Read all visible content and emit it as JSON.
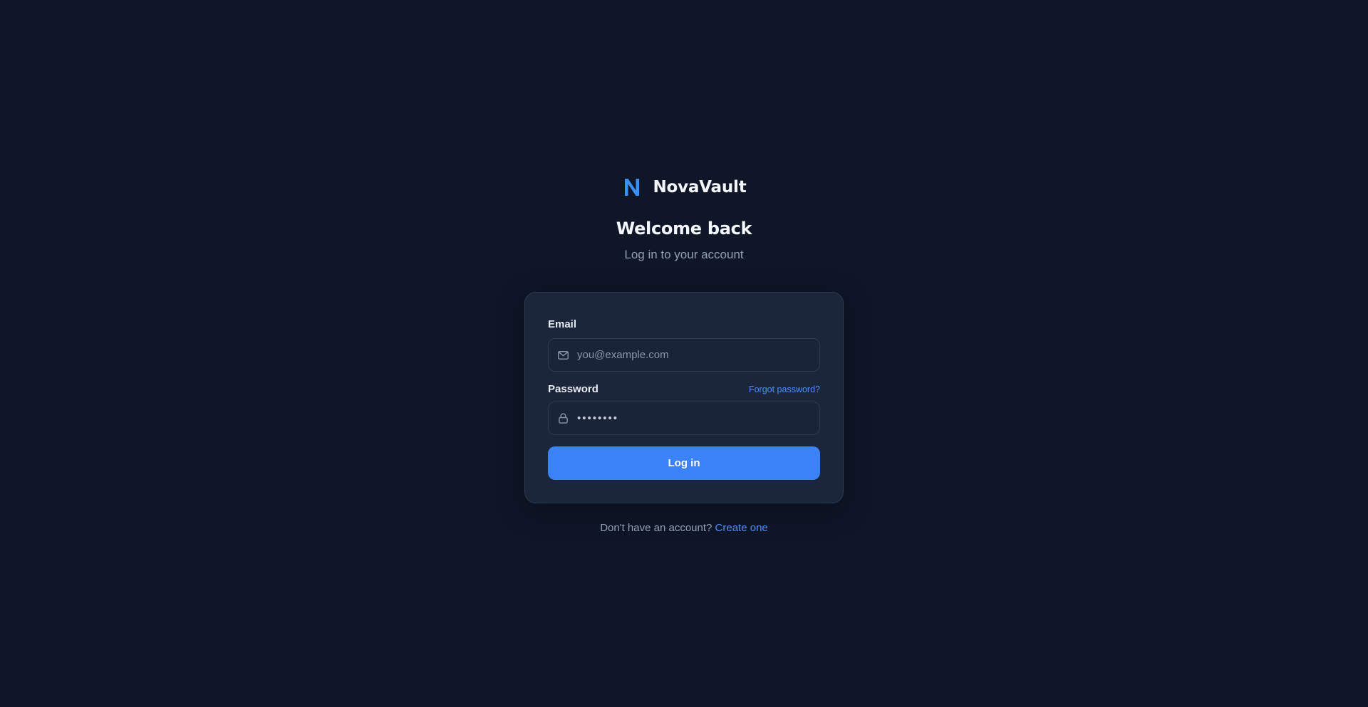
{
  "brand": {
    "name": "NovaVault",
    "logo_icon": "n-logo-icon",
    "logo_color": "#3b8ff0"
  },
  "header": {
    "title": "Welcome back",
    "subtitle": "Log in to your account"
  },
  "form": {
    "email": {
      "label": "Email",
      "placeholder": "you@example.com",
      "value": "",
      "icon": "mail-icon"
    },
    "password": {
      "label": "Password",
      "value": "••••••••",
      "icon": "lock-icon",
      "forgot_label": "Forgot password?"
    },
    "submit_label": "Log in"
  },
  "footer": {
    "prompt": "Don't have an account?",
    "link_label": "Create one"
  },
  "colors": {
    "background": "#0e1628",
    "card": "#1b263b",
    "accent": "#3b82f6",
    "link": "#4e8ef7"
  }
}
